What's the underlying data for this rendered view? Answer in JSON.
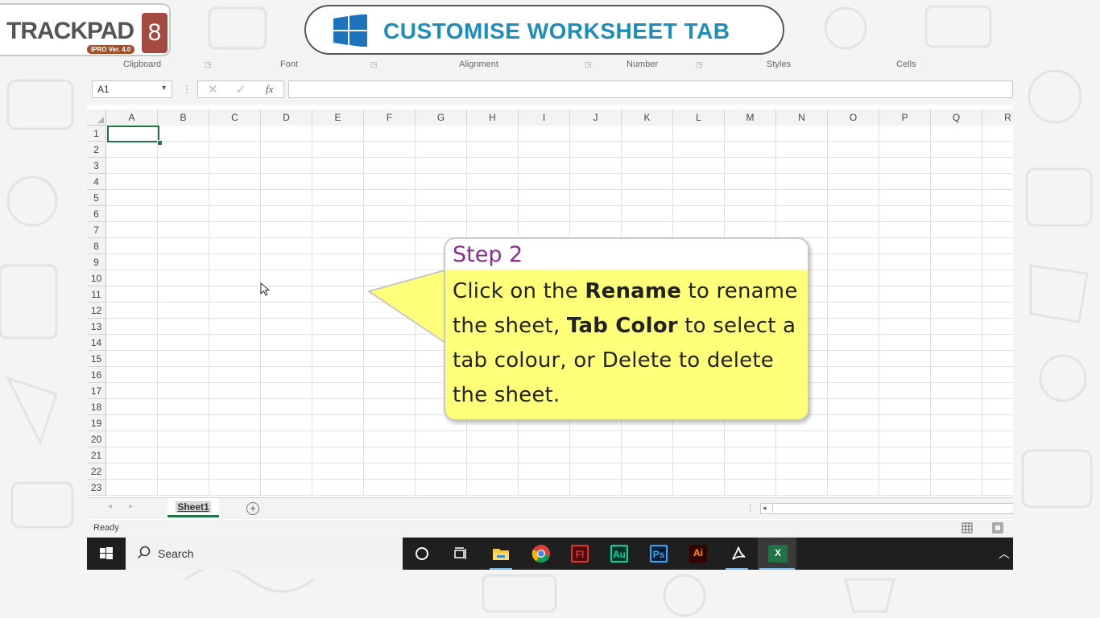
{
  "logo": {
    "text": "TRACKPAD",
    "version": "IPRO Ver. 4.0",
    "number": "8"
  },
  "title": {
    "text": "CUSTOMISE WORKSHEET TAB"
  },
  "ribbon": {
    "groups": [
      "Clipboard",
      "Font",
      "Alignment",
      "Number",
      "Styles",
      "Cells"
    ]
  },
  "formula_bar": {
    "name_box": "A1",
    "fx_label": "fx",
    "value": ""
  },
  "grid": {
    "columns": [
      "A",
      "B",
      "C",
      "D",
      "E",
      "F",
      "G",
      "H",
      "I",
      "J",
      "K",
      "L",
      "M",
      "N",
      "O",
      "P",
      "Q",
      "R"
    ],
    "rows": [
      "1",
      "2",
      "3",
      "4",
      "5",
      "6",
      "7",
      "8",
      "9",
      "10",
      "11",
      "12",
      "13",
      "14",
      "15",
      "16",
      "17",
      "18",
      "19",
      "20",
      "21",
      "22",
      "23"
    ],
    "active_cell": "A1"
  },
  "sheets": {
    "tabs": [
      "Sheet1"
    ],
    "active": "Sheet1",
    "add_symbol": "+"
  },
  "status": {
    "text": "Ready"
  },
  "taskbar": {
    "search_label": "Search",
    "apps": [
      {
        "name": "cortana",
        "label": ""
      },
      {
        "name": "task-view",
        "label": ""
      },
      {
        "name": "file-explorer",
        "label": ""
      },
      {
        "name": "chrome",
        "label": ""
      },
      {
        "name": "flash",
        "label": "Fl",
        "color": "#e8312f"
      },
      {
        "name": "audition",
        "label": "Au",
        "color": "#00d8a0"
      },
      {
        "name": "photoshop",
        "label": "Ps",
        "color": "#31a8ff"
      },
      {
        "name": "illustrator",
        "label": "Ai",
        "color": "#ff9a00"
      },
      {
        "name": "acrobat",
        "label": "",
        "color": "#ffffff"
      },
      {
        "name": "excel",
        "label": "X",
        "color": "#217346"
      }
    ]
  },
  "callout": {
    "title": "Step 2",
    "body": {
      "p1": "Click on the ",
      "b1": "Rename",
      "p2": " to rename the sheet, ",
      "b2": "Tab Color",
      "p3": " to select a tab colour, or Delete to delete the sheet."
    }
  },
  "colors": {
    "title_blue": "#1d8dbb",
    "excel_green": "#217346",
    "callout_yellow": "#ffff7a",
    "step_purple": "#8e2a8e"
  }
}
